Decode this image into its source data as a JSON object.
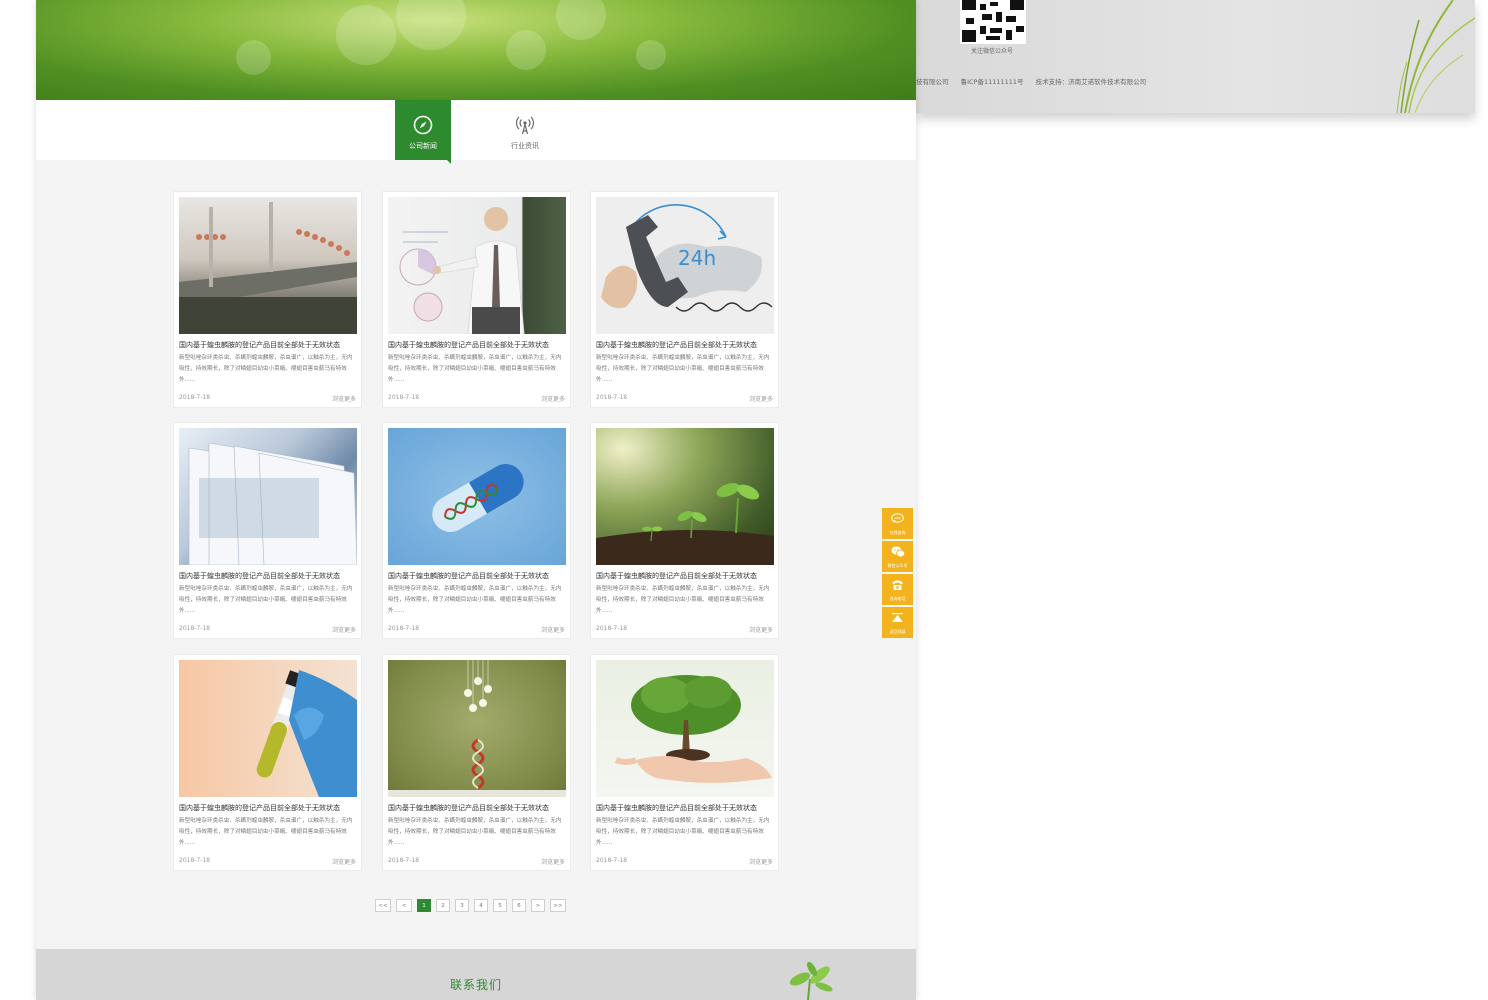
{
  "footer": {
    "qr_caption": "关注微信公众号",
    "copyright_fragment": "技有限公司",
    "icp": "鲁ICP备11111111号",
    "tech_support": "技术支持：济南艾诺软件技术有限公司"
  },
  "tabs": [
    {
      "label": "公司新闻",
      "icon": "compass-icon",
      "active": true
    },
    {
      "label": "行业资讯",
      "icon": "broadcast-antenna-icon",
      "active": false
    }
  ],
  "cards": [
    {
      "image": "factory-bottling-line",
      "title": "国内基于蝗虫麟胺的登记产品目前全部处于无效状态",
      "desc": "新型吡唑杂环类杀虫、杀螨剂蝗虫麟胺，杀虫谱广，以触杀为主，无内吸性，持效期长，除了对鳞翅目幼虫小菜蛾、缨翅目害虫蓟马有特效外......",
      "date": "2018-7-18",
      "more": "浏览更多"
    },
    {
      "image": "man-presenting-charts",
      "title": "国内基于蝗虫麟胺的登记产品目前全部处于无效状态",
      "desc": "新型吡唑杂环类杀虫、杀螨剂蝗虫麟胺，杀虫谱广，以触杀为主，无内吸性，持效期长，除了对鳞翅目幼虫小菜蛾、缨翅目害虫蓟马有特效外......",
      "date": "2018-7-18",
      "more": "浏览更多"
    },
    {
      "image": "telephone-24h-world-map",
      "title": "国内基于蝗虫麟胺的登记产品目前全部处于无效状态",
      "desc": "新型吡唑杂环类杀虫、杀螨剂蝗虫麟胺，杀虫谱广，以触杀为主，无内吸性，持效期长，除了对鳞翅目幼虫小菜蛾、缨翅目害虫蓟马有特效外......",
      "date": "2018-7-18",
      "more": "浏览更多",
      "image_text": "24h"
    },
    {
      "image": "stacked-documents",
      "title": "国内基于蝗虫麟胺的登记产品目前全部处于无效状态",
      "desc": "新型吡唑杂环类杀虫、杀螨剂蝗虫麟胺，杀虫谱广，以触杀为主，无内吸性，持效期长，除了对鳞翅目幼虫小菜蛾、缨翅目害虫蓟马有特效外......",
      "date": "2018-7-18",
      "more": "浏览更多"
    },
    {
      "image": "dna-capsule",
      "title": "国内基于蝗虫麟胺的登记产品目前全部处于无效状态",
      "desc": "新型吡唑杂环类杀虫、杀螨剂蝗虫麟胺，杀虫谱广，以触杀为主，无内吸性，持效期长，除了对鳞翅目幼虫小菜蛾、缨翅目害虫蓟马有特效外......",
      "date": "2018-7-18",
      "more": "浏览更多"
    },
    {
      "image": "seedlings-in-soil",
      "title": "国内基于蝗虫麟胺的登记产品目前全部处于无效状态",
      "desc": "新型吡唑杂环类杀虫、杀螨剂蝗虫麟胺，杀虫谱广，以触杀为主，无内吸性，持效期长，除了对鳞翅目幼虫小菜蛾、缨翅目害虫蓟马有特效外......",
      "date": "2018-7-18",
      "more": "浏览更多"
    },
    {
      "image": "test-tube-glove",
      "title": "国内基于蝗虫麟胺的登记产品目前全部处于无效状态",
      "desc": "新型吡唑杂环类杀虫、杀螨剂蝗虫麟胺，杀虫谱广，以触杀为主，无内吸性，持效期长，除了对鳞翅目幼虫小菜蛾、缨翅目害虫蓟马有特效外......",
      "date": "2018-7-18",
      "more": "浏览更多"
    },
    {
      "image": "lightbulbs-dna",
      "title": "国内基于蝗虫麟胺的登记产品目前全部处于无效状态",
      "desc": "新型吡唑杂环类杀虫、杀螨剂蝗虫麟胺，杀虫谱广，以触杀为主，无内吸性，持效期长，除了对鳞翅目幼虫小菜蛾、缨翅目害虫蓟马有特效外......",
      "date": "2018-7-18",
      "more": "浏览更多"
    },
    {
      "image": "tree-in-hands",
      "title": "国内基于蝗虫麟胺的登记产品目前全部处于无效状态",
      "desc": "新型吡唑杂环类杀虫、杀螨剂蝗虫麟胺，杀虫谱广，以触杀为主，无内吸性，持效期长，除了对鳞翅目幼虫小菜蛾、缨翅目害虫蓟马有特效外......",
      "date": "2018-7-18",
      "more": "浏览更多"
    }
  ],
  "pagination": {
    "first": "<<",
    "prev": "<",
    "pages": [
      "1",
      "2",
      "3",
      "4",
      "5",
      "6"
    ],
    "current": "1",
    "next": ">",
    "last": ">>"
  },
  "contact": {
    "title": "联系我们"
  },
  "side_toolbar": [
    {
      "label": "在线咨询",
      "icon": "chat-bubble-icon"
    },
    {
      "label": "微信公众号",
      "icon": "wechat-icon"
    },
    {
      "label": "咨询电话",
      "icon": "phone-icon"
    },
    {
      "label": "返回顶部",
      "icon": "back-to-top-icon"
    }
  ],
  "colors": {
    "brand_green": "#2e8a2e",
    "toolbar_yellow": "#f2b31e",
    "banner_green": "#4f8f22"
  }
}
